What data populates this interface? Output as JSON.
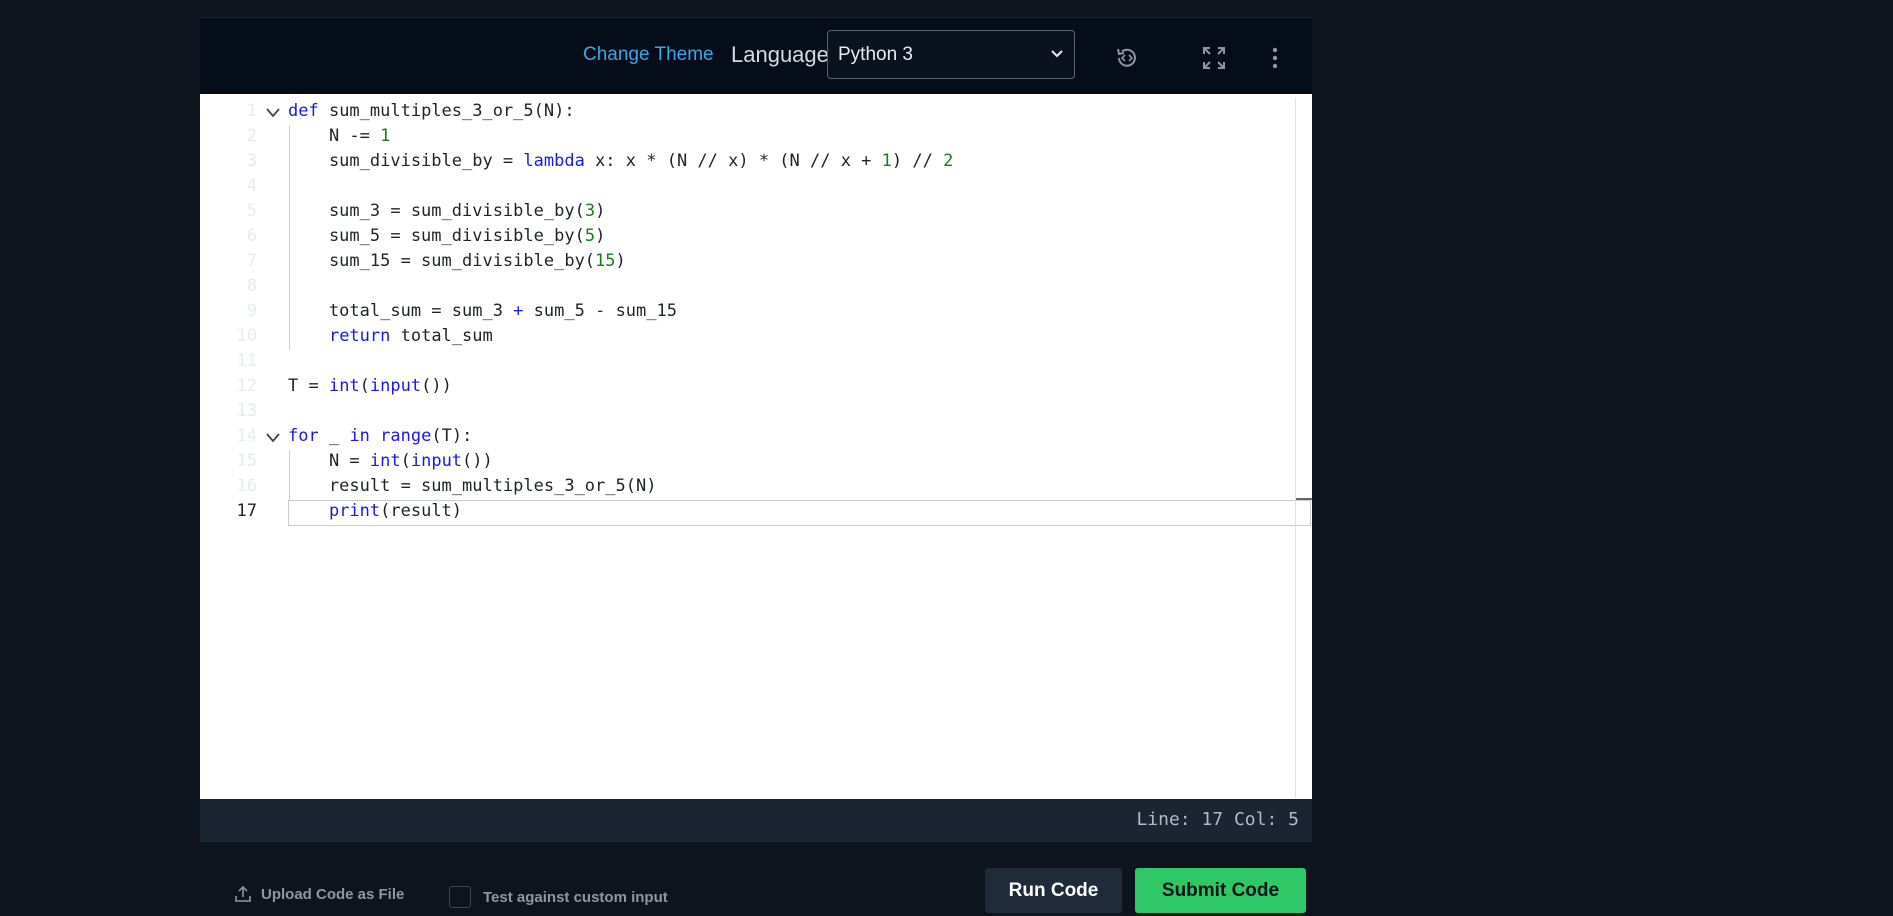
{
  "toolbar": {
    "change_theme": "Change Theme",
    "language_label": "Language",
    "language_value": "Python 3",
    "icons": [
      "history-icon",
      "fullscreen-icon",
      "more-vertical-icon"
    ]
  },
  "editor": {
    "lines": [
      {
        "n": "1",
        "fold": true,
        "tokens": [
          {
            "t": "def",
            "c": "kw"
          },
          {
            "t": " sum_multiples_3_or_5(N):"
          }
        ]
      },
      {
        "n": "2",
        "tokens": [
          {
            "t": "    N -= "
          },
          {
            "t": "1",
            "c": "num"
          }
        ]
      },
      {
        "n": "3",
        "tokens": [
          {
            "t": "    sum_divisible_by = "
          },
          {
            "t": "lambda",
            "c": "kw"
          },
          {
            "t": " x: x * (N // x) * (N // x + "
          },
          {
            "t": "1",
            "c": "num"
          },
          {
            "t": ") // "
          },
          {
            "t": "2",
            "c": "num"
          }
        ]
      },
      {
        "n": "4",
        "tokens": []
      },
      {
        "n": "5",
        "tokens": [
          {
            "t": "    sum_3 = sum_divisible_by("
          },
          {
            "t": "3",
            "c": "num"
          },
          {
            "t": ")"
          }
        ]
      },
      {
        "n": "6",
        "tokens": [
          {
            "t": "    sum_5 = sum_divisible_by("
          },
          {
            "t": "5",
            "c": "num"
          },
          {
            "t": ")"
          }
        ]
      },
      {
        "n": "7",
        "tokens": [
          {
            "t": "    sum_15 = sum_divisible_by("
          },
          {
            "t": "15",
            "c": "num"
          },
          {
            "t": ")"
          }
        ]
      },
      {
        "n": "8",
        "tokens": []
      },
      {
        "n": "9",
        "tokens": [
          {
            "t": "    total_sum = sum_3 "
          },
          {
            "t": "+",
            "c": "kw"
          },
          {
            "t": " sum_5 "
          },
          {
            "t": "-",
            "c": "kw"
          },
          {
            "t": " sum_15"
          }
        ]
      },
      {
        "n": "10",
        "tokens": [
          {
            "t": "    "
          },
          {
            "t": "return",
            "c": "kw"
          },
          {
            "t": " total_sum"
          }
        ]
      },
      {
        "n": "11",
        "tokens": []
      },
      {
        "n": "12",
        "tokens": [
          {
            "t": "T = "
          },
          {
            "t": "int",
            "c": "kw"
          },
          {
            "t": "("
          },
          {
            "t": "input",
            "c": "kw"
          },
          {
            "t": "())"
          }
        ]
      },
      {
        "n": "13",
        "tokens": []
      },
      {
        "n": "14",
        "fold": true,
        "tokens": [
          {
            "t": "for",
            "c": "kw"
          },
          {
            "t": " _ "
          },
          {
            "t": "in",
            "c": "kw"
          },
          {
            "t": " "
          },
          {
            "t": "range",
            "c": "kw"
          },
          {
            "t": "(T):"
          }
        ]
      },
      {
        "n": "15",
        "tokens": [
          {
            "t": "    N = "
          },
          {
            "t": "int",
            "c": "kw"
          },
          {
            "t": "("
          },
          {
            "t": "input",
            "c": "kw"
          },
          {
            "t": "())"
          }
        ]
      },
      {
        "n": "16",
        "tokens": [
          {
            "t": "    result = sum_multiples_3_or_5(N)"
          }
        ]
      },
      {
        "n": "17",
        "active": true,
        "tokens": [
          {
            "t": "    "
          },
          {
            "t": "print",
            "c": "kw"
          },
          {
            "t": "(result)"
          }
        ]
      }
    ]
  },
  "status": {
    "position": "Line: 17 Col: 5"
  },
  "footer": {
    "upload_label": "Upload Code as File",
    "custom_input_label": "Test against custom input",
    "run_label": "Run Code",
    "submit_label": "Submit Code"
  }
}
